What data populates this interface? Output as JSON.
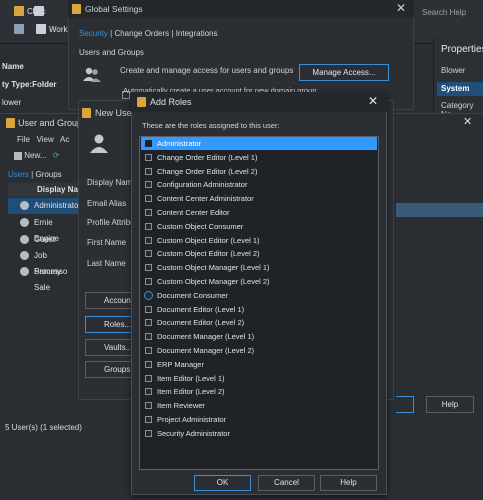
{
  "background": {
    "toolbar": {
      "check_label": "Chec",
      "work_label": "Work"
    },
    "search_placeholder": "Search Help",
    "left_panel": {
      "name_header": "Name",
      "type_row": "ty Type:Folder",
      "blower_row": "lower"
    }
  },
  "properties": {
    "title": "Properties",
    "blower": "Blower",
    "system": "System",
    "category_name": "Category Na"
  },
  "global_settings": {
    "title": "Global Settings",
    "tabs": [
      "Security",
      "Change Orders",
      "Integrations"
    ],
    "section": "Users and Groups",
    "description": "Create and manage access for users and groups",
    "manage_button": "Manage Access...",
    "auto_create": "Automatically create a user account for new domain group"
  },
  "users_window": {
    "title": "User and Group",
    "menu": [
      "File",
      "View",
      "Ac"
    ],
    "toolbar": {
      "new_label": "New..."
    },
    "tabs": [
      "Users",
      "Groups"
    ],
    "column_header": "Display Na",
    "users": [
      "Administrato",
      "Ernie Engine",
      "Guest",
      "Job Processo",
      "Sammy Sale"
    ],
    "status": "5 User(s) (1 selected)",
    "help_button": "Help"
  },
  "new_user": {
    "title": "New User",
    "labels": [
      "Display Name",
      "Email Alias",
      "Profile Attribu",
      "First Name",
      "Last Name"
    ],
    "buttons": [
      "Account",
      "Roles...",
      "Vaults...",
      "Groups"
    ]
  },
  "add_roles": {
    "title": "Add Roles",
    "description": "These are the roles assigned to this user:",
    "roles": [
      "Administrator",
      "Change Order Editor (Level 1)",
      "Change Order Editor (Level 2)",
      "Configuration Administrator",
      "Content Center Administrator",
      "Content Center Editor",
      "Custom Object Consumer",
      "Custom Object Editor (Level 1)",
      "Custom Object Editor (Level 2)",
      "Custom Object Manager (Level 1)",
      "Custom Object Manager (Level 2)",
      "Document Consumer",
      "Document Editor (Level 1)",
      "Document Editor (Level 2)",
      "Document Manager (Level 1)",
      "Document Manager (Level 2)",
      "ERP Manager",
      "Item Editor (Level 1)",
      "Item Editor (Level 2)",
      "Item Reviewer",
      "Project Administrator",
      "Security Administrator"
    ],
    "selected_index": 0,
    "hover_index": 11,
    "buttons": {
      "ok": "OK",
      "cancel": "Cancel",
      "help": "Help"
    }
  }
}
